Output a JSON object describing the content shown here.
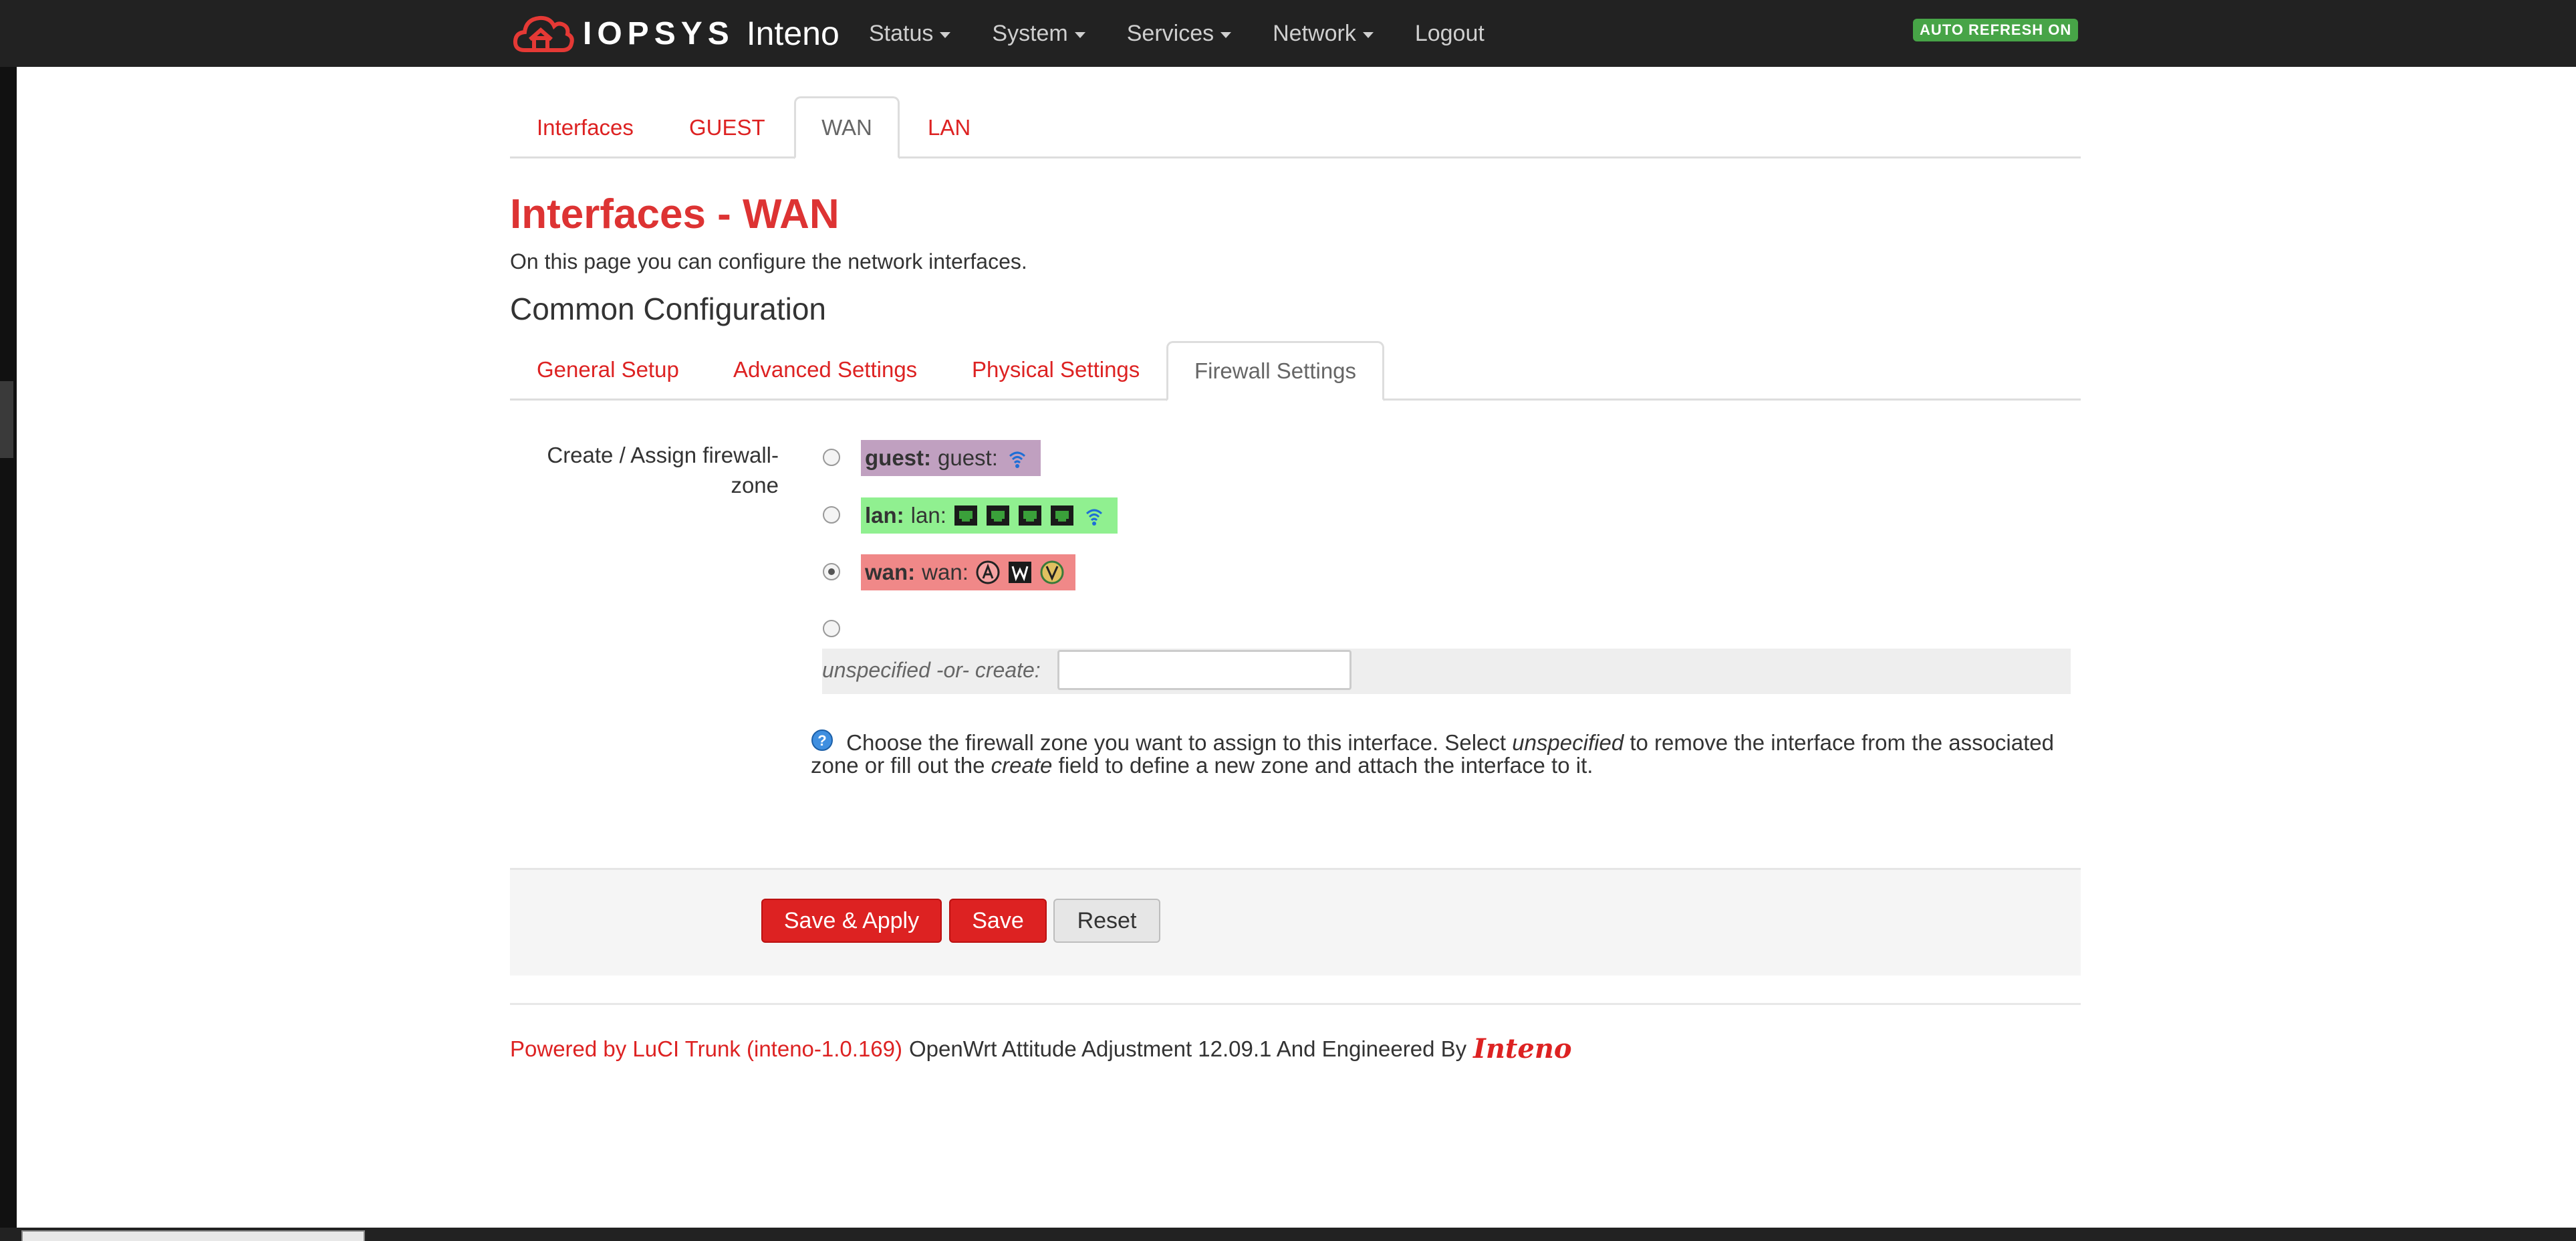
{
  "brand": {
    "logo_text": "IOPSYS",
    "product": "Inteno"
  },
  "nav": {
    "items": [
      {
        "label": "Status"
      },
      {
        "label": "System"
      },
      {
        "label": "Services"
      },
      {
        "label": "Network"
      },
      {
        "label": "Logout"
      }
    ],
    "auto_refresh": "AUTO REFRESH ON"
  },
  "tabs_top": [
    "Interfaces",
    "GUEST",
    "WAN",
    "LAN"
  ],
  "page": {
    "title": "Interfaces - WAN",
    "description": "On this page you can configure the network interfaces.",
    "section": "Common Configuration"
  },
  "tabs_sub": [
    "General Setup",
    "Advanced Settings",
    "Physical Settings",
    "Firewall Settings"
  ],
  "firewall": {
    "label": "Create / Assign firewall-zone",
    "zones": [
      {
        "name": "guest:",
        "sub": "guest:"
      },
      {
        "name": "lan:",
        "sub": "lan:"
      },
      {
        "name": "wan:",
        "sub": "wan:"
      }
    ],
    "create_label": "unspecified -or- create:",
    "create_value": "",
    "help_1": "Choose the firewall zone you want to assign to this interface. Select ",
    "help_em1": "unspecified",
    "help_2": " to remove the interface from the associated zone or fill out the ",
    "help_em2": "create",
    "help_3": " field to define a new zone and attach the interface to it."
  },
  "actions": {
    "save_apply": "Save & Apply",
    "save": "Save",
    "reset": "Reset"
  },
  "footer": {
    "powered": "Powered by LuCI Trunk (inteno-1.0.169)",
    "text": "OpenWrt Attitude Adjustment 12.09.1 And Engineered By",
    "logo": "Inteno"
  },
  "colors": {
    "accent": "#dd2222",
    "navbar": "#222222",
    "badge": "#47a447"
  }
}
